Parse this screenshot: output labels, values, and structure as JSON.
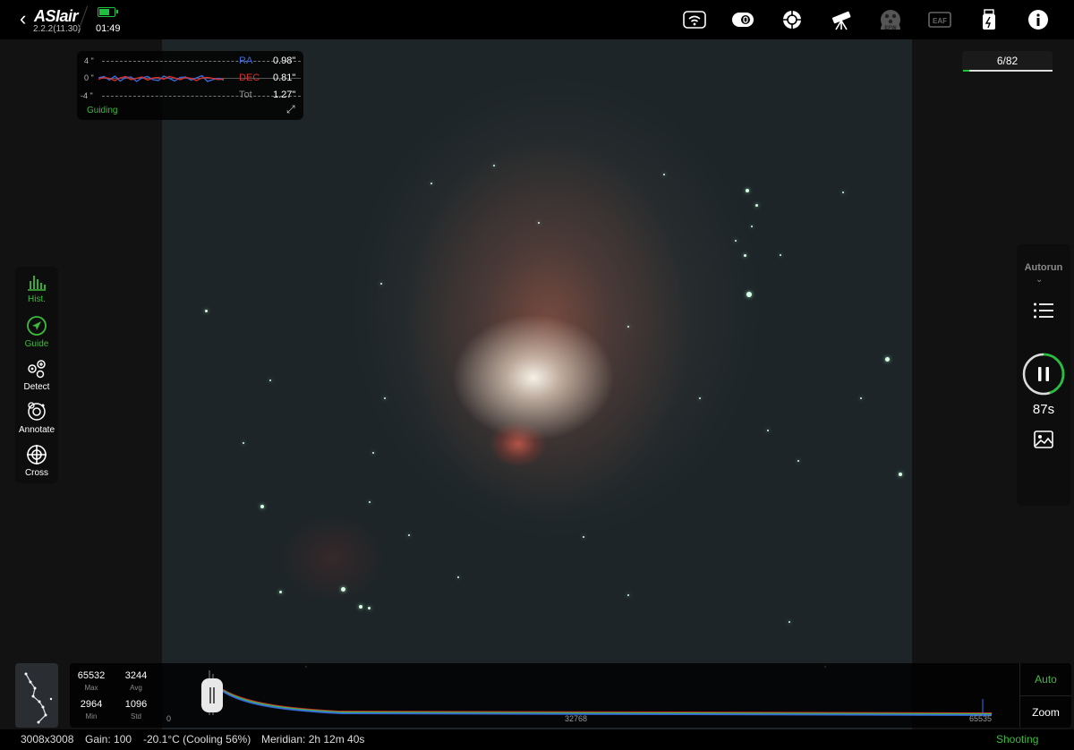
{
  "app": {
    "logo": "ASIair",
    "version": "2.2.2(11.30)",
    "clock": "01:49",
    "battery_level": 0.75,
    "accent": "#3cbc3c"
  },
  "toolbar_icons": [
    "wifi-icon",
    "camera-icon",
    "guide-scope-icon",
    "telescope-icon",
    "filter-wheel-icon",
    "focuser-icon",
    "storage-icon",
    "info-icon"
  ],
  "toolbar_labels": {
    "efw": "EFW",
    "eaf": "EAF"
  },
  "guiding": {
    "axis_top": "4 \"",
    "axis_mid": "0 \"",
    "axis_bot": "-4 \"",
    "ra_label": "RA",
    "ra_value": "0.98\"",
    "dec_label": "DEC",
    "dec_value": "0.81\"",
    "tot_label": "Tot",
    "tot_value": "1.27\"",
    "status": "Guiding",
    "ra_color": "#3a6ee8",
    "dec_color": "#e0302a",
    "ra_trace": [
      0.2,
      0.5,
      -0.3,
      0.6,
      -0.5,
      0.3,
      0.4,
      -0.6,
      0.2,
      0.5,
      -0.2,
      -0.4,
      0.6,
      0.1,
      -0.5,
      0.3,
      0.4,
      -0.3,
      0.2,
      0.7,
      -0.6,
      -0.2,
      0.1,
      -0.3
    ],
    "dec_trace": [
      -0.1,
      0.3,
      0.1,
      -0.4,
      0.2,
      0.5,
      -0.2,
      0.1,
      0.4,
      -0.3,
      0.2,
      0.3,
      -0.1,
      0.5,
      0.2,
      -0.2,
      0.3,
      0.1,
      -0.4,
      0.2,
      0.3,
      0.1,
      -0.2,
      0.0
    ]
  },
  "frames": {
    "label": "6/82",
    "current": 6,
    "total": 82
  },
  "left_toolbar": [
    {
      "label": "Hist.",
      "icon": "histogram-icon",
      "active": true
    },
    {
      "label": "Guide",
      "icon": "guide-icon",
      "active": true
    },
    {
      "label": "Detect",
      "icon": "detect-icon",
      "active": false
    },
    {
      "label": "Annotate",
      "icon": "annotate-icon",
      "active": false
    },
    {
      "label": "Cross",
      "icon": "crosshair-icon",
      "active": false
    }
  ],
  "autorun": {
    "label": "Autorun",
    "countdown": "87s",
    "exposure_progress": 0.45
  },
  "stats": {
    "max_value": "65532",
    "max_label": "Max",
    "avg_value": "3244",
    "avg_label": "Avg",
    "min_value": "2964",
    "min_label": "Min",
    "std_value": "1096",
    "std_label": "Std"
  },
  "histogram": {
    "tick_0": "0",
    "tick_mid": "32768",
    "tick_max": "65535",
    "auto_label": "Auto",
    "zoom_label": "Zoom"
  },
  "status": {
    "resolution": "3008x3008",
    "gain": "Gain: 100",
    "temperature": "-20.1°C (Cooling 56%)",
    "meridian": "Meridian: 2h 12m 40s",
    "state": "Shooting"
  }
}
